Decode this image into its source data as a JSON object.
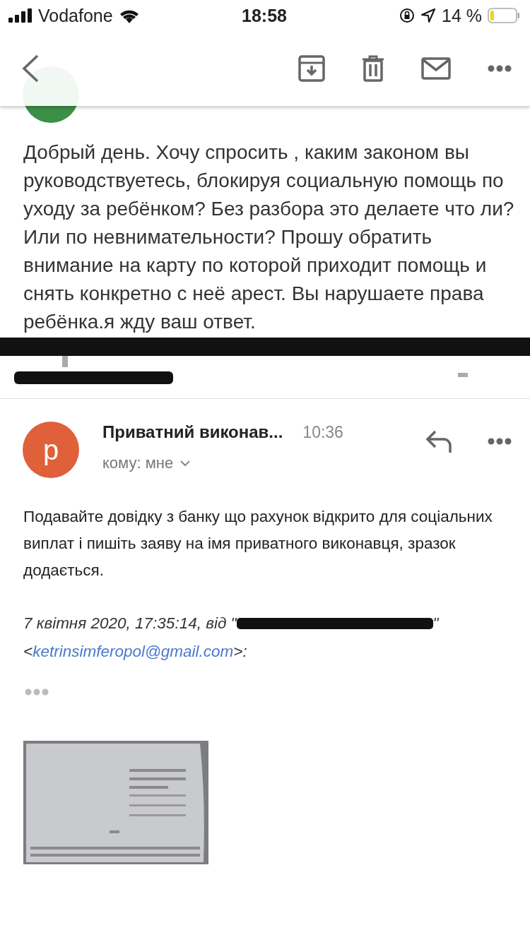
{
  "status_bar": {
    "carrier": "Vodafone",
    "time": "18:58",
    "battery": "14 %"
  },
  "first_message": {
    "body": "Добрый день. Хочу спросить , каким законом вы руководствуетесь, блокируя социальную помощь по уходу за ребёнком? Без разбора это делаете что ли? Или по невнимательности? Прошу обратить внимание на карту по которой приходит помощь и снять конкретно с неё арест. Вы нарушаете права ребёнка.я жду ваш ответ."
  },
  "second_message": {
    "avatar_letter": "p",
    "sender": "Приватний виконав...",
    "time": "10:36",
    "recipient": "кому: мне",
    "body": "Подавайте довідку з банку що рахунок відкрито для соціальних виплат і пишіть заяву на імя приватного виконавця, зразок додається.",
    "quote_header": "7 квітня 2020, 17:35:14, від \"",
    "quote_name_end": "\"",
    "quote_email_open": "<",
    "quote_email": "ketrinsimferopol@gmail.com",
    "quote_email_close": ">:"
  }
}
